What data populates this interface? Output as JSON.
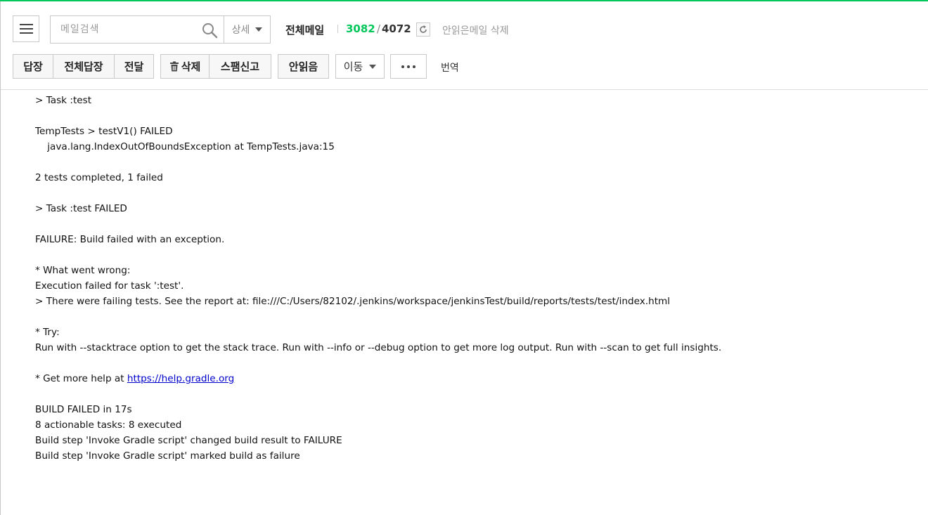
{
  "header": {
    "search": {
      "placeholder": "메일검색"
    },
    "detail_label": "상세",
    "mailbox_title": "전체메일",
    "unread_count": "3082",
    "slash": "/",
    "total_count": "4072",
    "delete_unread_label": "안읽은메일 삭제"
  },
  "toolbar": {
    "reply": "답장",
    "reply_all": "전체답장",
    "forward": "전달",
    "delete": "삭제",
    "spam": "스팸신고",
    "mark_unread": "안읽음",
    "move": "이동",
    "translate": "번역"
  },
  "colors": {
    "accent": "#03c75a",
    "link": "#0000cc"
  },
  "mail_body": {
    "lines": [
      "> Task :test",
      "",
      "TempTests > testV1() FAILED",
      "    java.lang.IndexOutOfBoundsException at TempTests.java:15",
      "",
      "2 tests completed, 1 failed",
      "",
      "> Task :test FAILED",
      "",
      "FAILURE: Build failed with an exception.",
      "",
      "* What went wrong:",
      "Execution failed for task ':test'.",
      "> There were failing tests. See the report at: file:///C:/Users/82102/.jenkins/workspace/jenkinsTest/build/reports/tests/test/index.html",
      "",
      "* Try:",
      "Run with --stacktrace option to get the stack trace. Run with --info or --debug option to get more log output. Run with --scan to get full insights.",
      ""
    ],
    "help_prefix": "* Get more help at ",
    "help_link": "https://help.gradle.org",
    "tail_lines": [
      "",
      "BUILD FAILED in 17s",
      "8 actionable tasks: 8 executed",
      "Build step 'Invoke Gradle script' changed build result to FAILURE",
      "Build step 'Invoke Gradle script' marked build as failure"
    ]
  }
}
